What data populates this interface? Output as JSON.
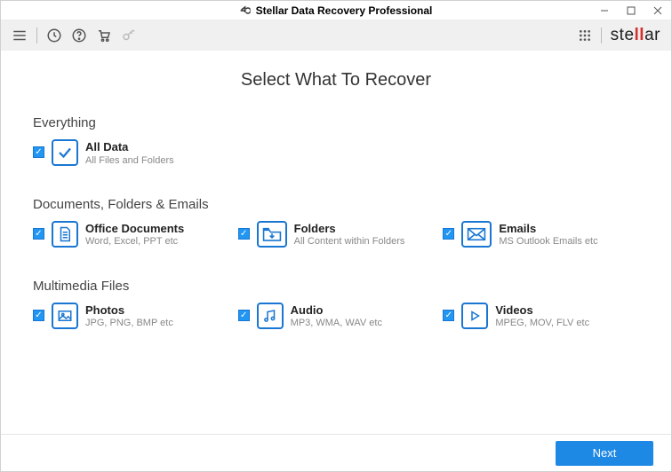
{
  "window": {
    "title": "Stellar Data Recovery Professional"
  },
  "brand": {
    "pre": "ste",
    "mid": "ll",
    "post": "ar"
  },
  "page": {
    "title": "Select What To Recover"
  },
  "everything": {
    "heading": "Everything",
    "allData": {
      "label": "All Data",
      "desc": "All Files and Folders"
    }
  },
  "docs": {
    "heading": "Documents, Folders & Emails",
    "office": {
      "label": "Office Documents",
      "desc": "Word, Excel, PPT etc"
    },
    "folders": {
      "label": "Folders",
      "desc": "All Content within Folders"
    },
    "emails": {
      "label": "Emails",
      "desc": "MS Outlook Emails etc"
    }
  },
  "media": {
    "heading": "Multimedia Files",
    "photos": {
      "label": "Photos",
      "desc": "JPG, PNG, BMP etc"
    },
    "audio": {
      "label": "Audio",
      "desc": "MP3, WMA, WAV etc"
    },
    "videos": {
      "label": "Videos",
      "desc": "MPEG, MOV, FLV etc"
    }
  },
  "footer": {
    "next": "Next"
  }
}
